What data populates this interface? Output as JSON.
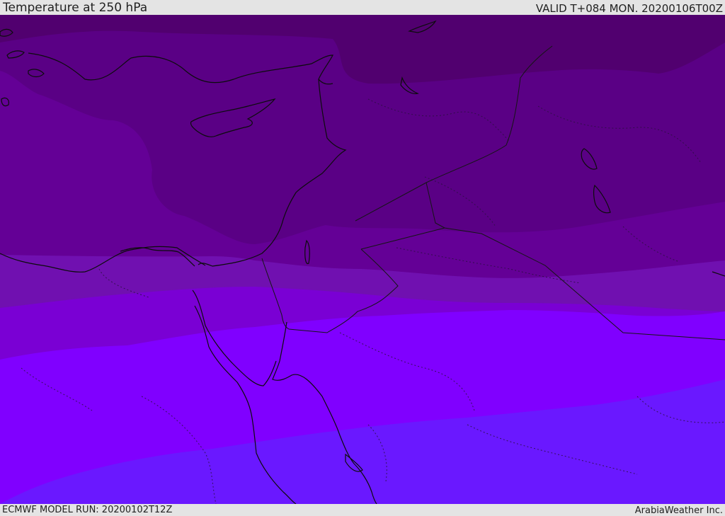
{
  "header": {
    "title": "Temperature at 250 hPa",
    "valid": "VALID T+084 MON. 20200106T00Z"
  },
  "footer": {
    "model_run": "ECMWF MODEL RUN: 20200102T12Z",
    "credit": "ArabiaWeather Inc."
  },
  "colors": {
    "band_coldest": "#51006f",
    "band_1": "#5a0085",
    "band_2": "#640096",
    "band_3": "#7010b0",
    "band_4": "#7a00d4",
    "band_5": "#8000ff",
    "band_6": "#6a18ff",
    "coastline": "#111111",
    "border": "#222222"
  }
}
